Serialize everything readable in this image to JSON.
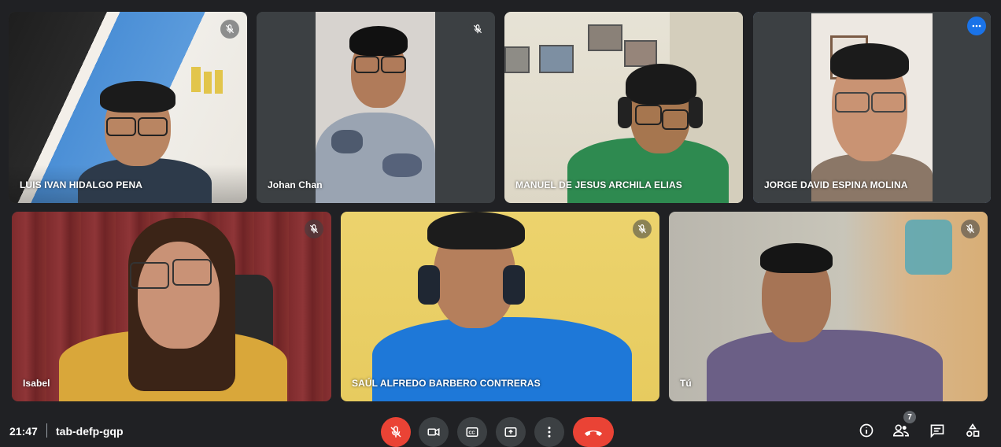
{
  "participants": [
    {
      "name": "LUIS IVAN HIDALGO PENA",
      "muted": true
    },
    {
      "name": "Johan Chan",
      "muted": true
    },
    {
      "name": "MANUEL DE JESUS ARCHILA ELIAS",
      "muted": false
    },
    {
      "name": "JORGE DAVID ESPINA MOLINA",
      "muted": false,
      "active": true
    },
    {
      "name": "Isabel",
      "muted": true
    },
    {
      "name": "SAÚL ALFREDO BARBERO CONTRERAS",
      "muted": true
    },
    {
      "name": "Tú",
      "muted": true
    }
  ],
  "meeting": {
    "time": "21:47",
    "code": "tab-defp-gqp"
  },
  "controls": {
    "mic": "mic-off-icon",
    "camera": "camera-icon",
    "captions": "closed-captions-icon",
    "present": "present-screen-icon",
    "more": "more-options-icon",
    "end_call": "end-call-icon"
  },
  "right_panel": {
    "people_count": "7"
  },
  "colors": {
    "background": "#202124",
    "tile": "#3c4043",
    "danger": "#ea4335",
    "active_border": "#8ab4f8",
    "accent": "#1a73e8"
  }
}
